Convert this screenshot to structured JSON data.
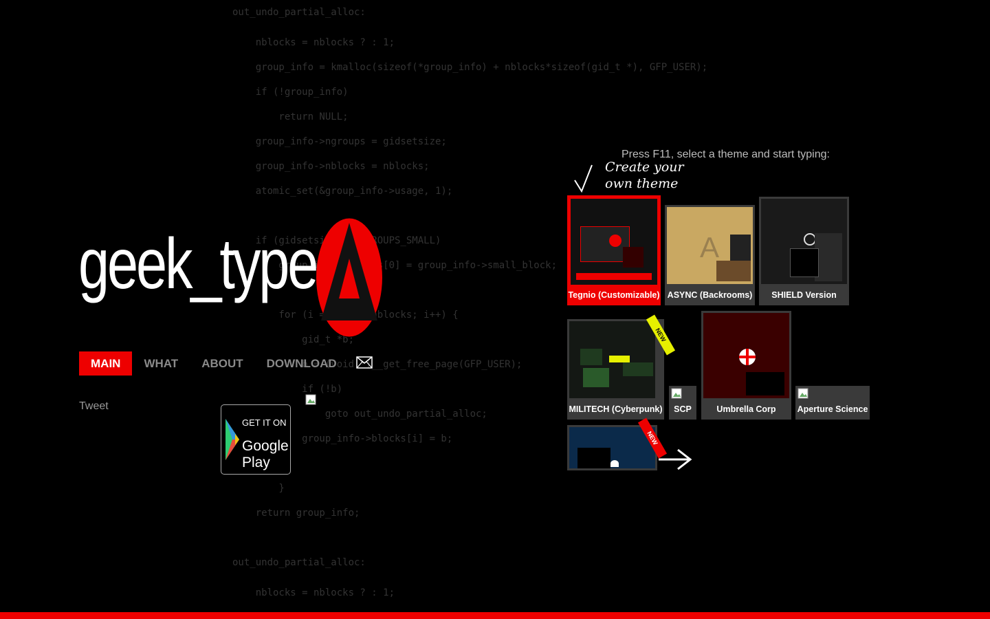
{
  "background_code": [
    "out_undo_partial_alloc:",
    "    nblocks = nblocks ? : 1;",
    "    group_info = kmalloc(sizeof(*group_info) + nblocks*sizeof(gid_t *), GFP_USER);",
    "    if (!group_info)",
    "        return NULL;",
    "    group_info->ngroups = gidsetsize;",
    "    group_info->nblocks = nblocks;",
    "    atomic_set(&group_info->usage, 1);",
    "    if (gidsetsize <= NGROUPS_SMALL)",
    "        group_info->blocks[0] = group_info->small_block;",
    "        for (i = 0; i < nblocks; i++) {",
    "            gid_t *b;",
    "            b = (void *)__get_free_page(GFP_USER);",
    "            if (!b)",
    "                goto out_undo_partial_alloc;",
    "            group_info->blocks[i] = b;",
    "        }",
    "    return group_info;",
    "out_undo_partial_alloc:",
    "    nblocks = nblocks ? : 1;"
  ],
  "logo": {
    "text": "geek_typer|"
  },
  "nav": {
    "items": [
      {
        "label": "MAIN",
        "active": true
      },
      {
        "label": "WHAT",
        "active": false
      },
      {
        "label": "ABOUT",
        "active": false
      },
      {
        "label": "DOWNLOAD",
        "active": false
      }
    ]
  },
  "social": {
    "tweet_label": "Tweet"
  },
  "google_play": {
    "small": "GET IT ON",
    "big": "Google Play"
  },
  "themes_panel": {
    "hint": "Press F11, select a theme and start typing:",
    "create_note_line1": "Create your",
    "create_note_line2": "own theme",
    "tiles": [
      {
        "label": "Tegnio (Customizable)",
        "selected": true
      },
      {
        "label": "ASYNC (Backrooms)",
        "selected": false
      },
      {
        "label": "SHIELD Version",
        "selected": false
      },
      {
        "label": "MILITECH (Cyberpunk)",
        "selected": false,
        "badge": "NEW"
      },
      {
        "label": "SCP",
        "selected": false
      },
      {
        "label": "Umbrella Corp",
        "selected": false
      },
      {
        "label": "Aperture Science",
        "selected": false
      },
      {
        "label": "",
        "selected": false,
        "badge": "NEW"
      }
    ]
  },
  "colors": {
    "accent": "#e00000",
    "background": "#000000",
    "code": "#333333"
  }
}
